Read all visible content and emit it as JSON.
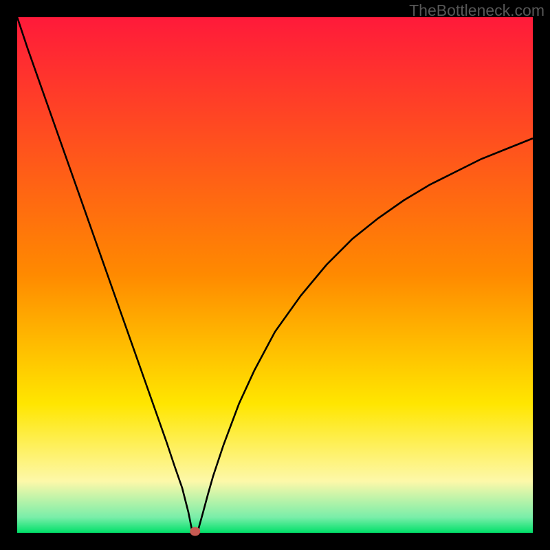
{
  "watermark": "TheBottleneck.com",
  "colors": {
    "frame": "#000000",
    "curve": "#000000",
    "green": "#00e069",
    "lightgreen": "#79eea9",
    "paleyellow": "#fdf8a9",
    "yellow": "#ffe600",
    "orange": "#ff8a00",
    "red": "#ff1a3a",
    "dot": "#c75a52"
  },
  "chart_data": {
    "type": "line",
    "title": "",
    "xlabel": "",
    "ylabel": "",
    "xlim": [
      0,
      100
    ],
    "ylim": [
      0,
      100
    ],
    "x": [
      0,
      2,
      5,
      8,
      11,
      14,
      17,
      20,
      23,
      26,
      29,
      30.5,
      32,
      33.2,
      34,
      34.5,
      35,
      36,
      37,
      38,
      40,
      43,
      46,
      50,
      55,
      60,
      65,
      70,
      75,
      80,
      85,
      90,
      95,
      100
    ],
    "y": [
      100,
      94,
      85.5,
      77,
      68.5,
      60,
      51.5,
      43,
      34.5,
      26,
      17.5,
      13,
      8.7,
      4,
      0,
      0,
      0.2,
      3.8,
      7.5,
      11,
      17,
      25,
      31.5,
      39,
      46,
      52,
      57,
      61,
      64.5,
      67.5,
      70,
      72.5,
      74.5,
      76.5
    ],
    "min_point": {
      "x": 34.5,
      "y": 0
    }
  }
}
